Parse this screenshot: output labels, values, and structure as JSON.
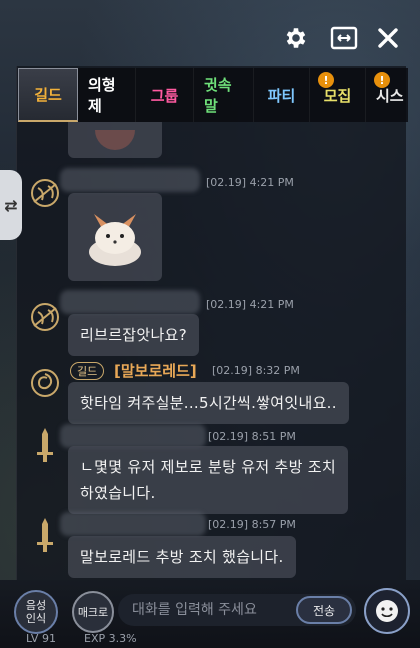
{
  "controls": {
    "settings": "gear-icon",
    "resize": "resize-icon",
    "close": "close-icon"
  },
  "tabs": [
    {
      "label": "길드",
      "color": "#f2b13a",
      "active": true,
      "badge": ""
    },
    {
      "label": "의형제",
      "color": "#ffffff",
      "active": false,
      "badge": ""
    },
    {
      "label": "그룹",
      "color": "#ff5aa0",
      "active": false,
      "badge": ""
    },
    {
      "label": "귓속말",
      "color": "#6fe07a",
      "active": false,
      "badge": ""
    },
    {
      "label": "파티",
      "color": "#7fc8ff",
      "active": false,
      "badge": ""
    },
    {
      "label": "모집",
      "color": "#e8e06a",
      "active": false,
      "badge": "!"
    },
    {
      "label": "시스",
      "color": "#e8e8e8",
      "active": false,
      "badge": "!"
    }
  ],
  "messages": [
    {
      "time": "[02.19] 4:21 PM",
      "type": "sticker"
    },
    {
      "time": "[02.19] 4:21 PM",
      "type": "text",
      "text": "리브르잡앗나요?"
    },
    {
      "guild_tag": "길드",
      "sender": "[말보로레드]",
      "time": "[02.19] 8:32 PM",
      "type": "text",
      "text": "핫타임 켜주실분...5시간씩.쌓여잇내요.."
    },
    {
      "time": "[02.19] 8:51 PM",
      "type": "text",
      "text": "ㄴ몇몇 유저 제보로 분탕 유저 추방 조치\n하였습니다."
    },
    {
      "time": "[02.19] 8:57 PM",
      "type": "text",
      "text": "말보로레드 추방 조치 했습니다."
    }
  ],
  "bottom": {
    "voice_label": "음성\n인식",
    "macro_label": "매크로",
    "input_placeholder": "대화를 입력해 주세요",
    "send_label": "전송",
    "emoji_icon": "emoji-icon",
    "level_text": "LV 91",
    "exp_text": "EXP 3.3%"
  }
}
